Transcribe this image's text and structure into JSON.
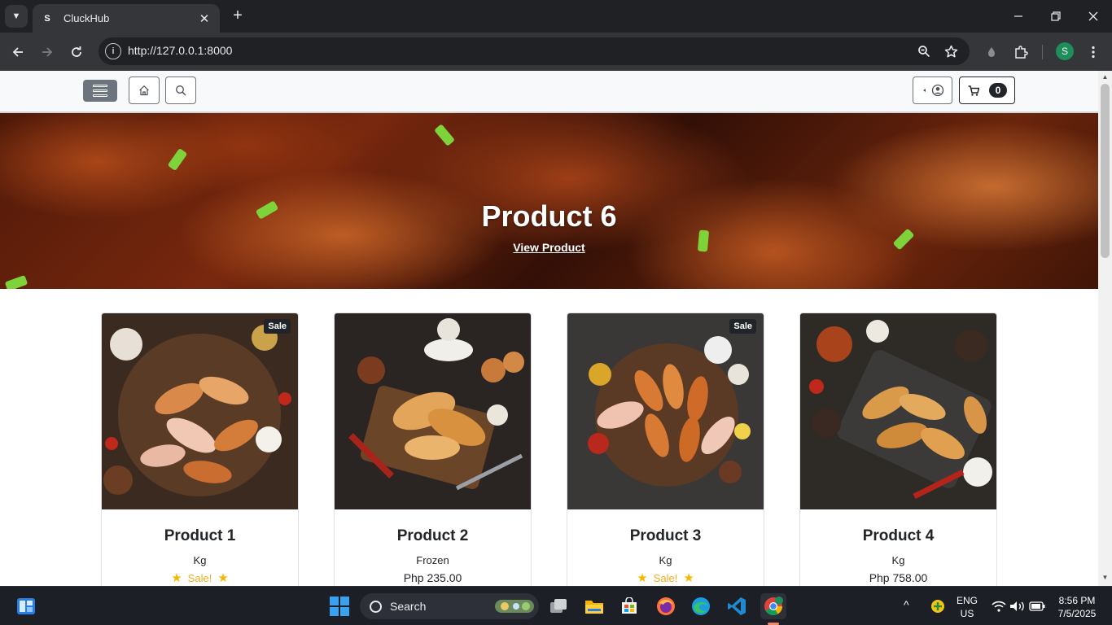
{
  "browser": {
    "tab_title": "CluckHub",
    "tab_favicon": "S",
    "url": "http://127.0.0.1:8000",
    "profile_initial": "S"
  },
  "site": {
    "cart_count": "0"
  },
  "hero": {
    "title": "Product 6",
    "link": "View Product"
  },
  "products": [
    {
      "name": "Product 1",
      "unit": "Kg",
      "sale_text": "Sale!",
      "badge": "Sale"
    },
    {
      "name": "Product 2",
      "unit": "Frozen",
      "price": "Php 235.00"
    },
    {
      "name": "Product 3",
      "unit": "Kg",
      "sale_text": "Sale!",
      "badge": "Sale"
    },
    {
      "name": "Product 4",
      "unit": "Kg",
      "price": "Php 758.00"
    }
  ],
  "taskbar": {
    "search_label": "Search",
    "language": "ENG",
    "region": "US",
    "time": "8:56 PM",
    "date": "7/5/2025"
  },
  "colors": {
    "accent_sale": "#f0ad1a",
    "dark": "#212529",
    "chrome_bg": "#202124"
  }
}
